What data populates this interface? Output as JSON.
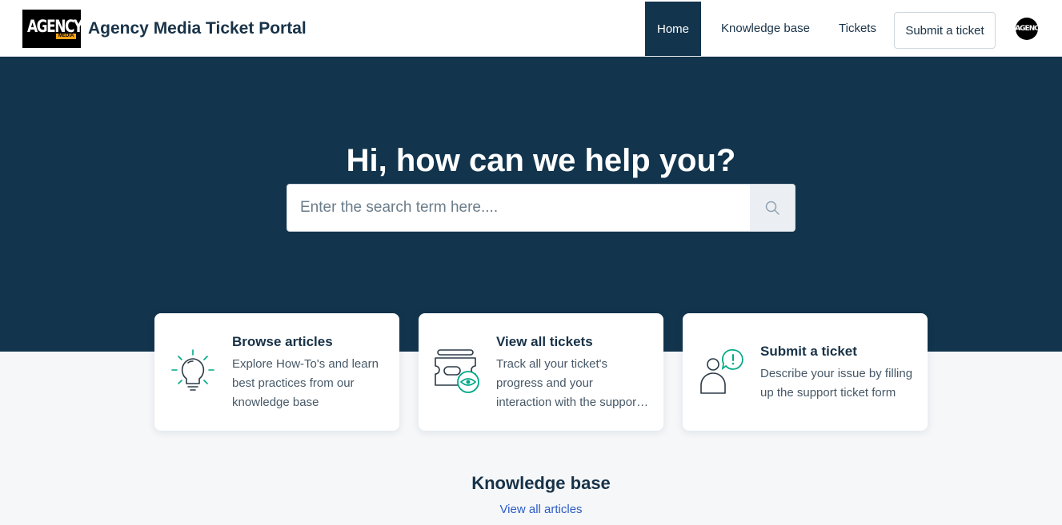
{
  "header": {
    "logo_text": "AGENCY",
    "logo_subtext": "MEDIA",
    "portal_title": "Agency Media Ticket Portal",
    "nav": {
      "home": "Home",
      "knowledge_base": "Knowledge base",
      "tickets": "Tickets",
      "submit_ticket": "Submit a ticket"
    },
    "avatar_text": "AGENC"
  },
  "hero": {
    "title": "Hi, how can we help you?",
    "search_placeholder": "Enter the search term here....",
    "search_icon": "search-icon"
  },
  "cards": [
    {
      "icon": "lightbulb-icon",
      "title": "Browse articles",
      "description": "Explore How-To's and learn best practices from our knowledge base"
    },
    {
      "icon": "ticket-view-icon",
      "title": "View all tickets",
      "description": "Track all your ticket's progress and your interaction with the support team"
    },
    {
      "icon": "user-alert-icon",
      "title": "Submit a ticket",
      "description": "Describe your issue by filling up the support ticket form"
    }
  ],
  "knowledge_base": {
    "title": "Knowledge base",
    "view_all": "View all articles"
  },
  "colors": {
    "brand_dark": "#12344d",
    "accent_green": "#00a886",
    "link_blue": "#2c5cc5",
    "background": "#f5f7f9"
  }
}
